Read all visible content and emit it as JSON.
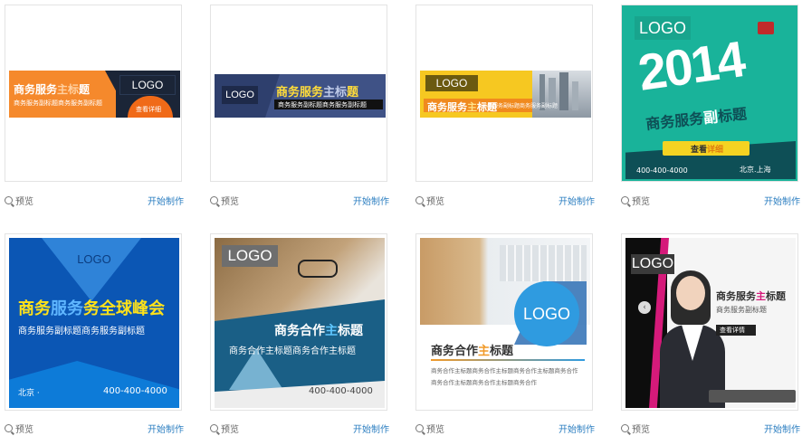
{
  "actions": {
    "preview_label": "预览",
    "start_label": "开始制作"
  },
  "cards": [
    {
      "logo": "LOGO",
      "title_a": "商务服务",
      "title_b": "主标",
      "title_c": "题",
      "subtitle": "商务服务副标题商务服务副标题",
      "button": "查看详细"
    },
    {
      "logo": "LOGO",
      "title_a": "商务服务",
      "title_b": "主标",
      "title_c": "题",
      "subtitle": "商务服务副标题商务服务副标题"
    },
    {
      "logo": "LOGO",
      "title_a": "商务服务",
      "title_b": "主",
      "title_c": "标题",
      "subtitle": "商务服务副标题商务服务副标题"
    },
    {
      "logo": "LOGO",
      "year": "2014",
      "title_a": "商务服务",
      "title_b": "副",
      "title_c": "标题",
      "button_a": "查看",
      "button_b": "详细",
      "phone": "400-400-4000",
      "city": "北京.上海"
    },
    {
      "logo": "LOGO",
      "title_a": "商务",
      "title_b": "服务",
      "title_c": "务全球峰会",
      "subtitle": "商务服务副标题商务服务副标题",
      "city": "北京 ·",
      "phone": "400-400-4000"
    },
    {
      "logo": "LOGO",
      "title_a": "商务合作",
      "title_b": "主",
      "title_c": "标题",
      "subtitle": "商务合作主标题商务合作主标题",
      "phone": "400-400-4000"
    },
    {
      "logo": "LOGO",
      "title_a": "商务合作",
      "title_b": "主",
      "title_c": "标题",
      "line1": "商务合作主标题商务合作主标题商务合作主标题商务合作",
      "line2": "商务合作主标题商务合作主标题商务合作"
    },
    {
      "logo": "LOGO",
      "title_a": "商务服务",
      "title_b": "主",
      "title_c": "标题",
      "subtitle": "商务服务副标题",
      "button": "查看详情"
    }
  ],
  "colors": {
    "link": "#2d7fc1",
    "orange": "#f57a20",
    "navy": "#1d2a4e",
    "teal": "#1ab39a",
    "blue": "#0b56b4"
  }
}
